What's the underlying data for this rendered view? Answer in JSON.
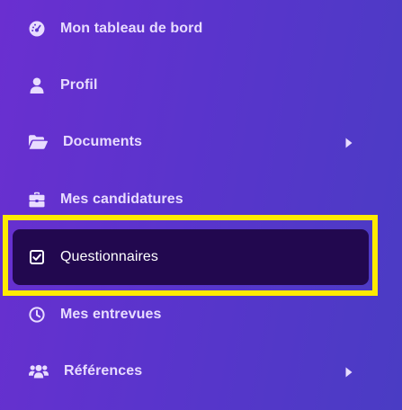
{
  "sidebar": {
    "items": [
      {
        "label": "Mon tableau de bord",
        "icon": "dashboard-icon",
        "has_submenu": false,
        "active": false
      },
      {
        "label": "Profil",
        "icon": "user-icon",
        "has_submenu": false,
        "active": false
      },
      {
        "label": "Documents",
        "icon": "folder-open-icon",
        "has_submenu": true,
        "active": false
      },
      {
        "label": "Mes candidatures",
        "icon": "briefcase-icon",
        "has_submenu": false,
        "active": false
      },
      {
        "label": "Questionnaires",
        "icon": "checkbox-icon",
        "has_submenu": false,
        "active": true
      },
      {
        "label": "Mes entrevues",
        "icon": "clock-icon",
        "has_submenu": false,
        "active": false
      },
      {
        "label": "Références",
        "icon": "users-icon",
        "has_submenu": true,
        "active": false
      }
    ]
  },
  "colors": {
    "background_start": "#6a2fd0",
    "background_end": "#4a3cc4",
    "active_item": "#22084f",
    "highlight": "#ffea00",
    "text": "#e8dcff"
  }
}
